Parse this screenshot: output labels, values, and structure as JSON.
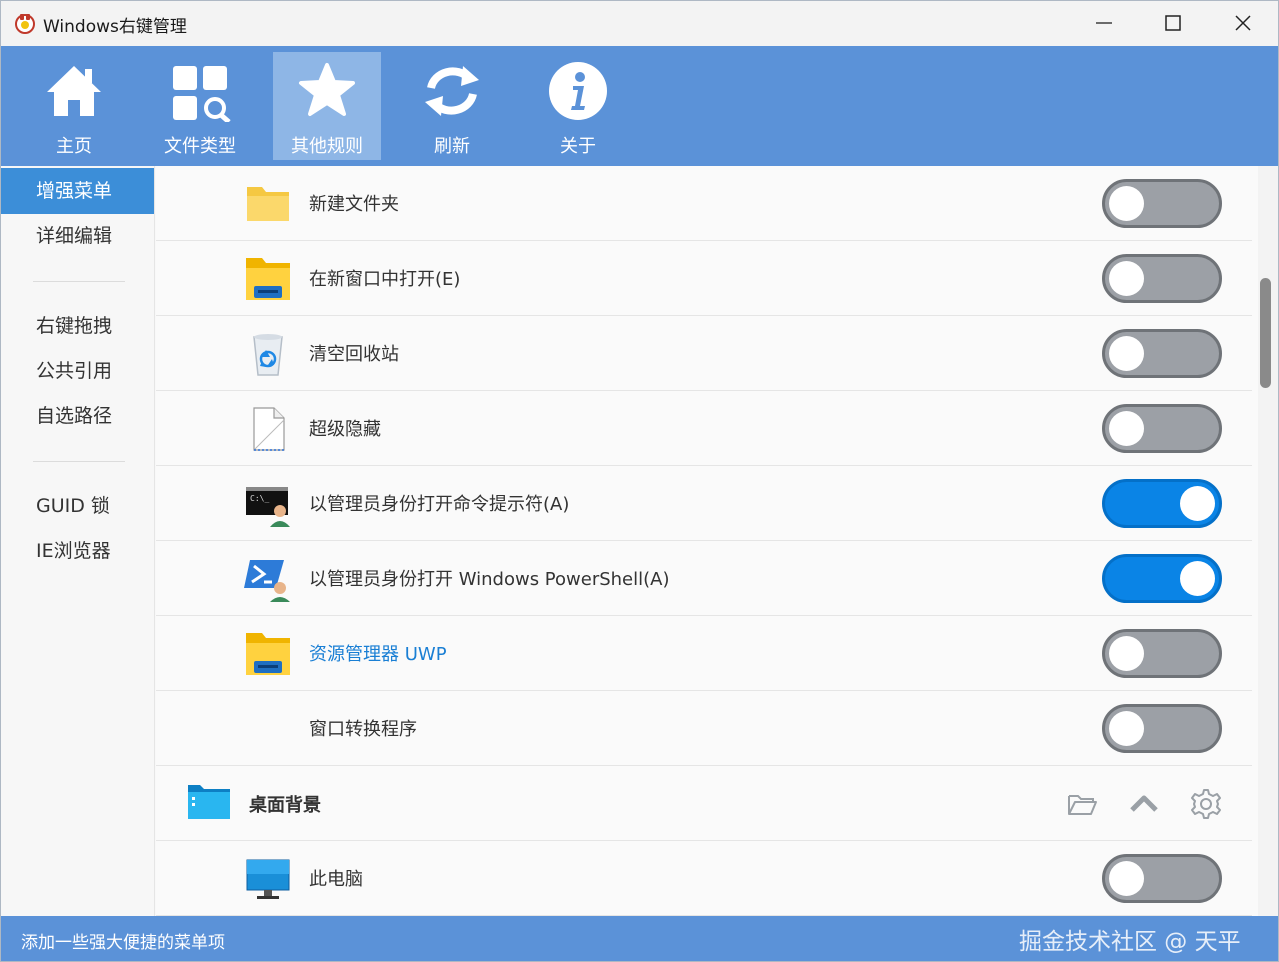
{
  "window": {
    "title": "Windows右键管理"
  },
  "toolbar": {
    "items": [
      {
        "label": "主页",
        "icon": "home-icon"
      },
      {
        "label": "文件类型",
        "icon": "file-types-icon"
      },
      {
        "label": "其他规则",
        "icon": "star-icon",
        "active": true
      },
      {
        "label": "刷新",
        "icon": "refresh-icon"
      },
      {
        "label": "关于",
        "icon": "info-icon"
      }
    ]
  },
  "sidebar": {
    "items": [
      {
        "label": "增强菜单",
        "active": true
      },
      {
        "label": "详细编辑"
      },
      {
        "label": "右键拖拽"
      },
      {
        "label": "公共引用"
      },
      {
        "label": "自选路径"
      },
      {
        "label": "GUID 锁"
      },
      {
        "label": "IE浏览器"
      }
    ]
  },
  "rules": [
    {
      "label": "新建文件夹",
      "icon": "folder-icon",
      "enabled": false
    },
    {
      "label": "在新窗口中打开(E)",
      "icon": "explorer-folder-icon",
      "enabled": false
    },
    {
      "label": "清空回收站",
      "icon": "recycle-bin-icon",
      "enabled": false
    },
    {
      "label": "超级隐藏",
      "icon": "blank-file-icon",
      "enabled": false
    },
    {
      "label": "以管理员身份打开命令提示符(A)",
      "icon": "cmd-admin-icon",
      "enabled": true
    },
    {
      "label": "以管理员身份打开 Windows PowerShell(A)",
      "icon": "powershell-admin-icon",
      "enabled": true
    },
    {
      "label": "资源管理器 UWP",
      "icon": "explorer-folder-icon",
      "enabled": false,
      "highlight": true
    },
    {
      "label": "窗口转换程序",
      "icon": "",
      "enabled": false
    }
  ],
  "group": {
    "label": "桌面背景",
    "icon": "desktop-folder-icon"
  },
  "rules_after": [
    {
      "label": "此电脑",
      "icon": "monitor-icon",
      "enabled": false
    }
  ],
  "status": {
    "text": "添加一些强大便捷的菜单项",
    "watermark": "掘金技术社区 @ 天平"
  },
  "colors": {
    "toolbar": "#5b92d8",
    "toolbar_active": "#8eb6e6",
    "sidebar_active": "#3c8ed8",
    "toggle_on": "#0a84e6",
    "toggle_off": "#9ca0a6",
    "highlight_text": "#1a7fd4"
  }
}
